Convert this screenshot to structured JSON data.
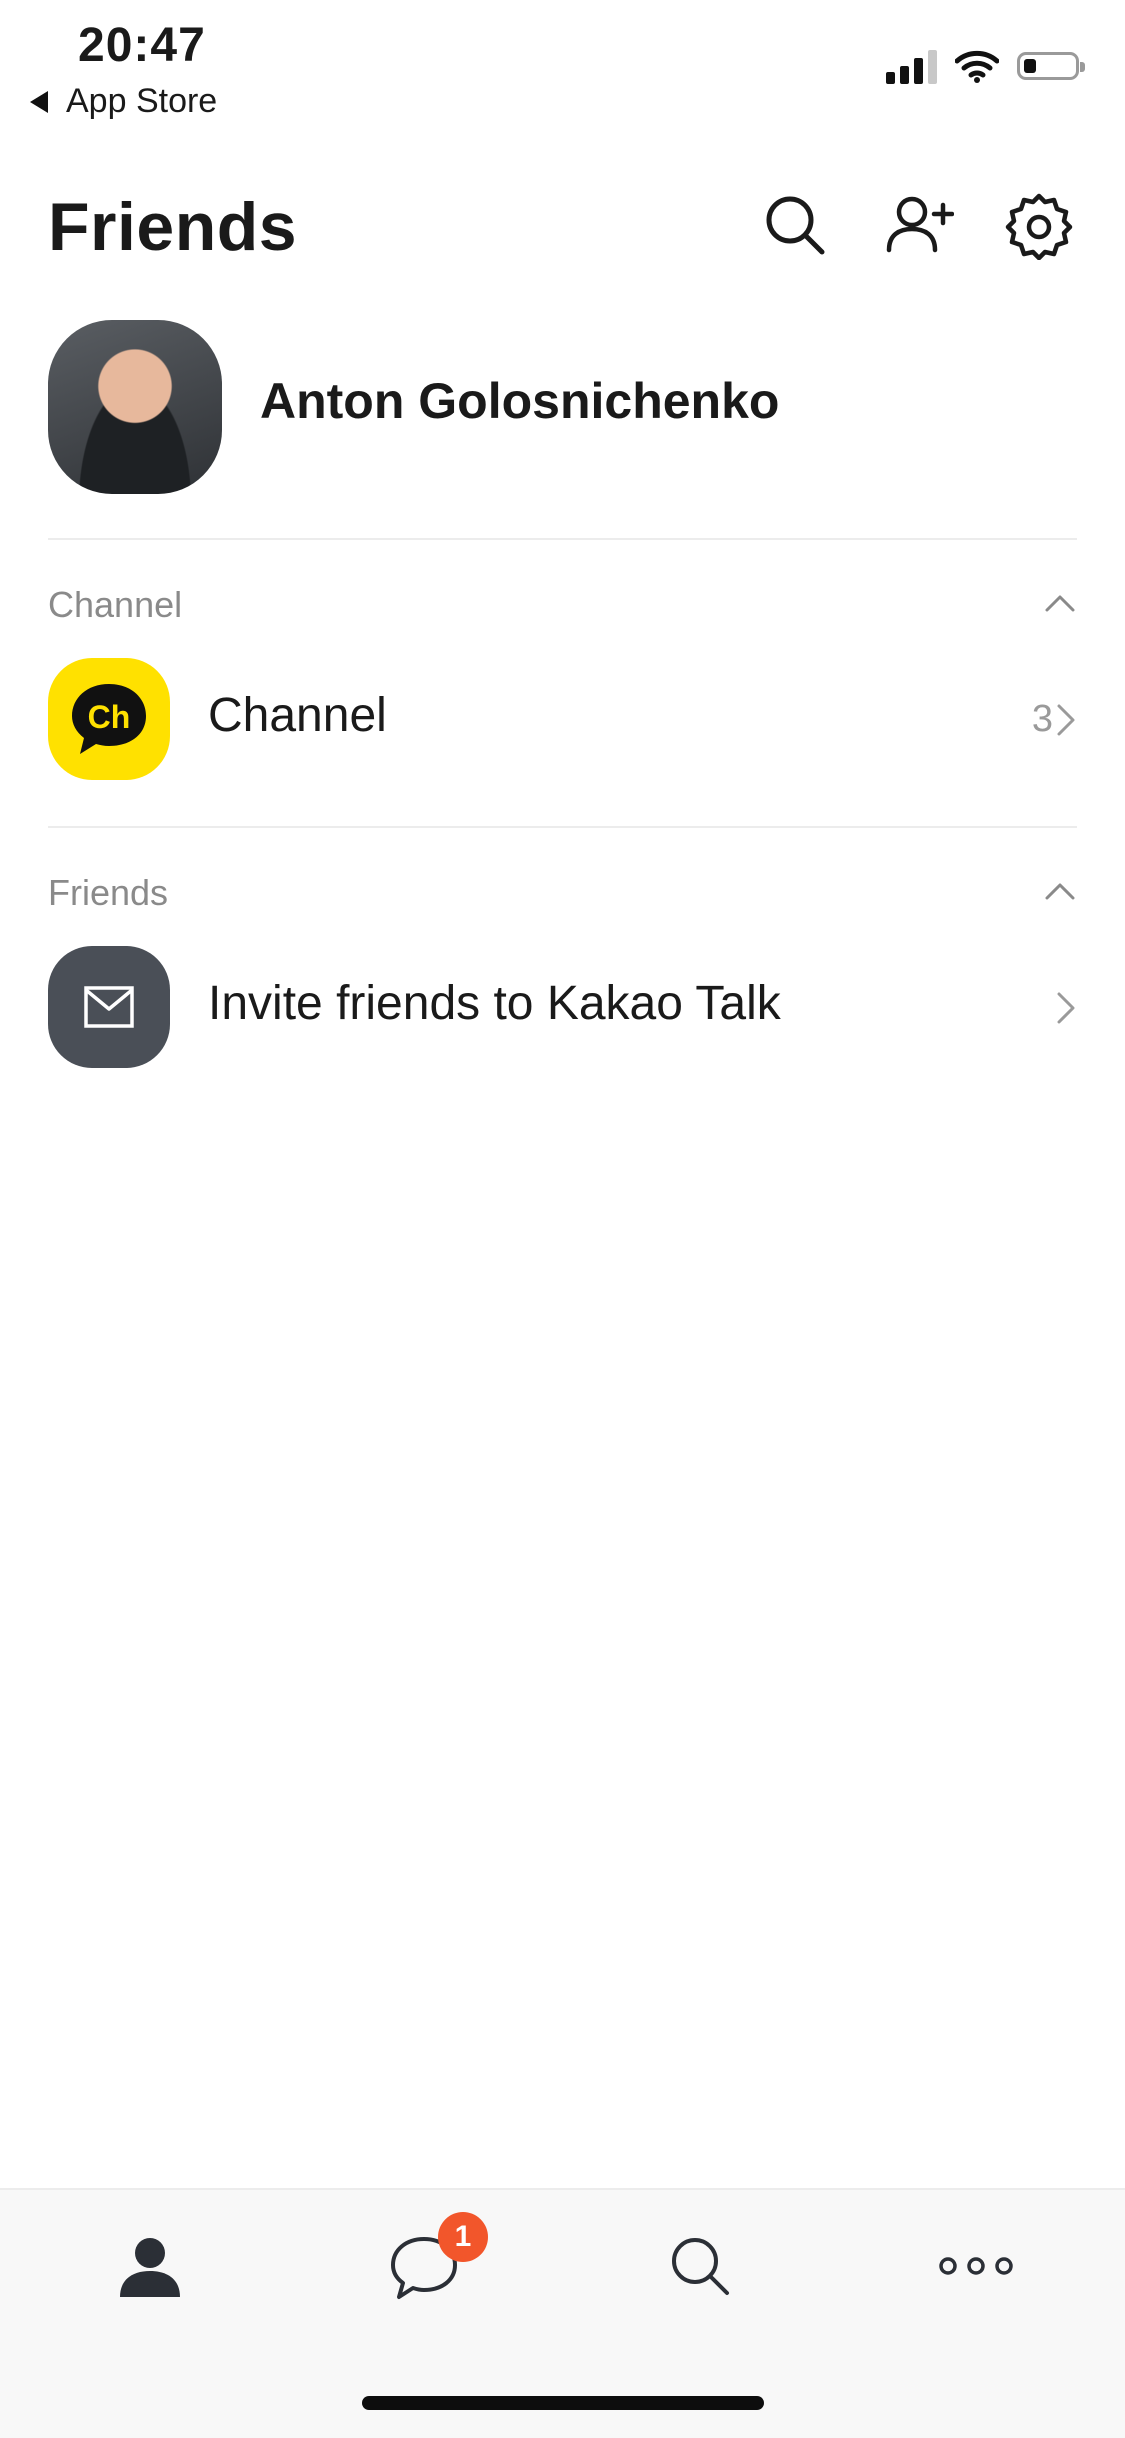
{
  "status_bar": {
    "time": "20:47",
    "back_label": "App Store",
    "icons": [
      "signal-icon",
      "wifi-icon",
      "battery-icon"
    ]
  },
  "header": {
    "title": "Friends",
    "actions": [
      "search-icon",
      "add-friend-icon",
      "settings-icon"
    ]
  },
  "profile": {
    "name": "Anton Golosnichenko"
  },
  "sections": {
    "channel": {
      "label": "Channel",
      "row_label": "Channel",
      "count": "3"
    },
    "friends": {
      "label": "Friends",
      "row_label": "Invite friends to Kakao Talk"
    }
  },
  "tabbar": {
    "tabs": [
      "friends-tab",
      "chats-tab",
      "search-tab",
      "more-tab"
    ],
    "chats_badge": "1"
  },
  "colors": {
    "channel_yellow": "#ffe100",
    "invite_icon_bg": "#4a4f57",
    "badge": "#f2562b"
  }
}
